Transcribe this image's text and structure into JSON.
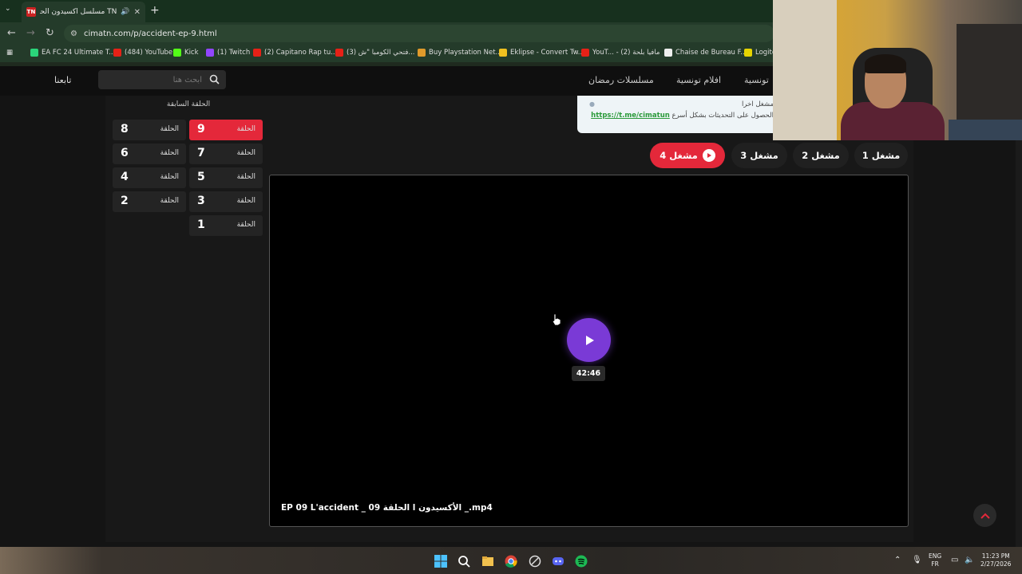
{
  "browser": {
    "tab_title": "TN مسلسل أكسيدون الحلقة",
    "tab_favicon": "TN",
    "url": "cimatn.com/p/accident-ep-9.html",
    "bookmarks": [
      {
        "label": "EA FC 24 Ultimate T...",
        "color": "#2bd47a"
      },
      {
        "label": "(484) YouTube",
        "color": "#e62117"
      },
      {
        "label": "Kick",
        "color": "#53fc18"
      },
      {
        "label": "(1) Twitch",
        "color": "#9146ff"
      },
      {
        "label": "(2) Capitano Rap tu...",
        "color": "#e62117"
      },
      {
        "label": "(3) فتحي الكومبا \"ش...",
        "color": "#e62117"
      },
      {
        "label": "Buy Playstation Net...",
        "color": "#e09a2b"
      },
      {
        "label": "Eklipse - Convert Tw...",
        "color": "#f0c020"
      },
      {
        "label": "YouT... - مافيا بلحة (2)",
        "color": "#e62117"
      },
      {
        "label": "Chaise de Bureau F...",
        "color": "#eeeeee"
      },
      {
        "label": "Logite",
        "color": "#e6d400"
      }
    ]
  },
  "header": {
    "nav": [
      "تونسية",
      "افلام تونسية",
      "مسلسلات رمضان"
    ],
    "search_placeholder": "ابحث هنا",
    "follow_label": "تابعنا"
  },
  "sidebar": {
    "title": "الحلقة السابقة",
    "episode_label": "الحلقة",
    "episodes": [
      {
        "num": "9",
        "active": true
      },
      {
        "num": "8",
        "active": false
      },
      {
        "num": "7",
        "active": false
      },
      {
        "num": "6",
        "active": false
      },
      {
        "num": "5",
        "active": false
      },
      {
        "num": "4",
        "active": false
      },
      {
        "num": "3",
        "active": false
      },
      {
        "num": "2",
        "active": false
      },
      {
        "num": "1",
        "active": false
      }
    ]
  },
  "notice": {
    "line1": "مشغل اخرا",
    "line2_prefix": "الحصول على التحديثات بشكل أسرع",
    "link": "https://t.me/cimatun"
  },
  "servers": [
    "مشغل 1",
    "مشغل 2",
    "مشغل 3",
    "مشغل 4"
  ],
  "active_server": "مشغل 4",
  "player": {
    "duration": "42:46",
    "filename": "EP 09 L'accident _ الحلقة 09 l الأكسيدون _.mp4"
  },
  "taskbar": {
    "lang_top": "ENG",
    "lang_bottom": "FR",
    "time": "11:23 PM",
    "date": "2/27/2026"
  },
  "colors": {
    "accent": "#e4283a",
    "play": "#7a3ad6",
    "link": "#2a9a3a"
  }
}
